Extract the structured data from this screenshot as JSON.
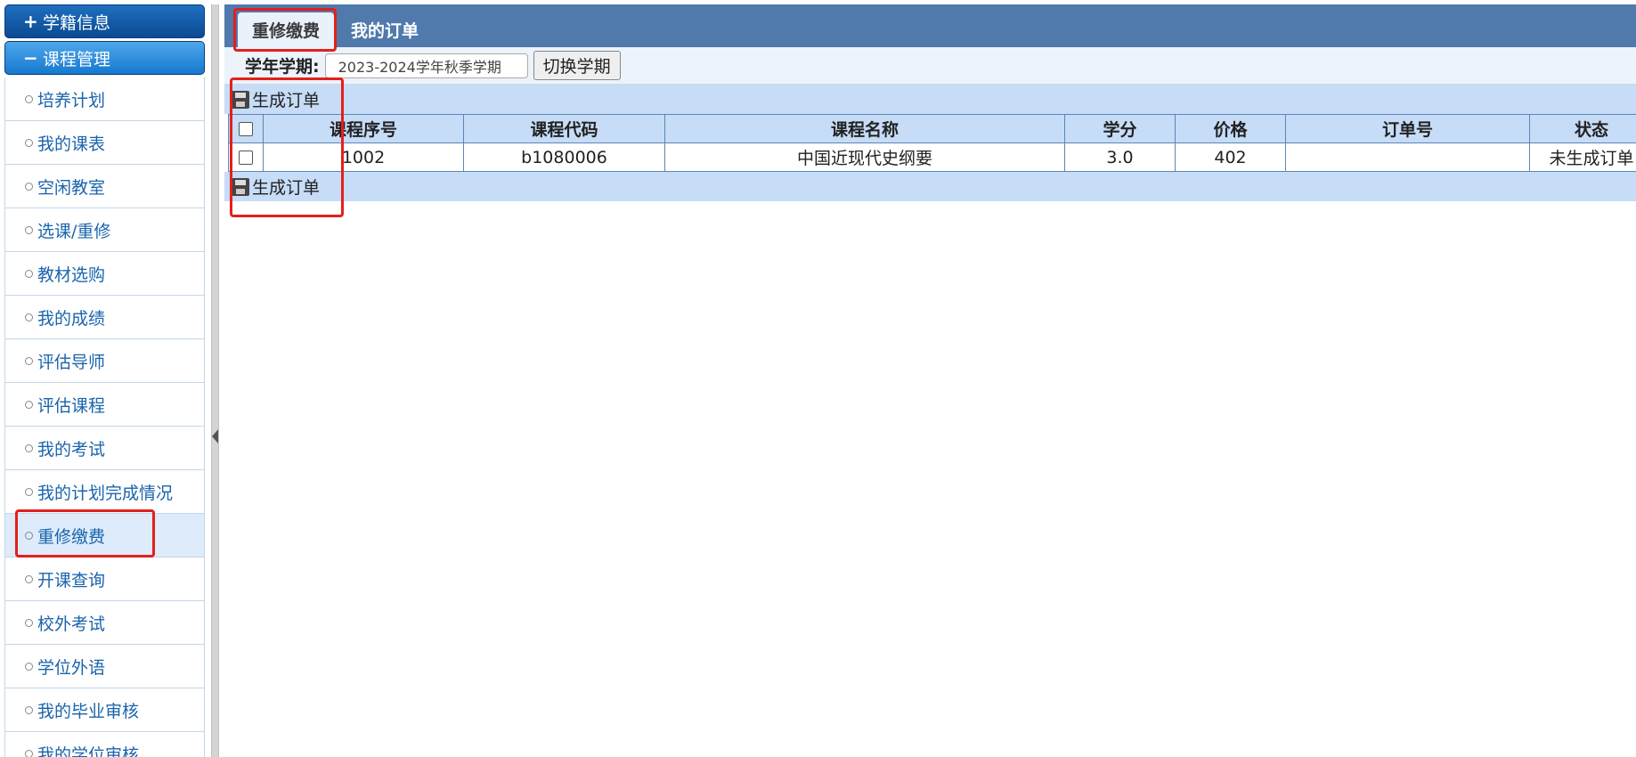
{
  "sidebar": {
    "sections": [
      {
        "sign": "+",
        "label": "学籍信息"
      },
      {
        "sign": "−",
        "label": "课程管理"
      }
    ],
    "items": [
      {
        "label": "培养计划"
      },
      {
        "label": "我的课表"
      },
      {
        "label": "空闲教室"
      },
      {
        "label": "选课/重修"
      },
      {
        "label": "教材选购"
      },
      {
        "label": "我的成绩"
      },
      {
        "label": "评估导师"
      },
      {
        "label": "评估课程"
      },
      {
        "label": "我的考试"
      },
      {
        "label": "我的计划完成情况"
      },
      {
        "label": "重修缴费"
      },
      {
        "label": "开课查询"
      },
      {
        "label": "校外考试"
      },
      {
        "label": "学位外语"
      },
      {
        "label": "我的毕业审核"
      },
      {
        "label": "我的学位审核"
      }
    ],
    "active_item": "重修缴费"
  },
  "tabs": [
    {
      "label": "重修缴费",
      "active": true
    },
    {
      "label": "我的订单",
      "active": false
    }
  ],
  "term": {
    "label": "学年学期:",
    "value": "2023-2024学年秋季学期",
    "switch_label": "切换学期"
  },
  "actions": {
    "generate_order_label": "生成订单"
  },
  "table": {
    "columns": [
      "课程序号",
      "课程代码",
      "课程名称",
      "学分",
      "价格",
      "订单号",
      "状态"
    ],
    "rows": [
      {
        "seq": "1002",
        "code": "b1080006",
        "name": "中国近现代史纲要",
        "credit": "3.0",
        "price": "402",
        "order_no": "",
        "status": "未生成订单"
      }
    ]
  },
  "colors": {
    "tab_bar": "#5079ac",
    "header_bg": "#c6dcf7",
    "link": "#1a64ac",
    "highlight": "#e3201b"
  },
  "icons": [
    "plus-icon",
    "minus-icon",
    "bullet-icon",
    "save-icon",
    "collapse-left-icon"
  ]
}
